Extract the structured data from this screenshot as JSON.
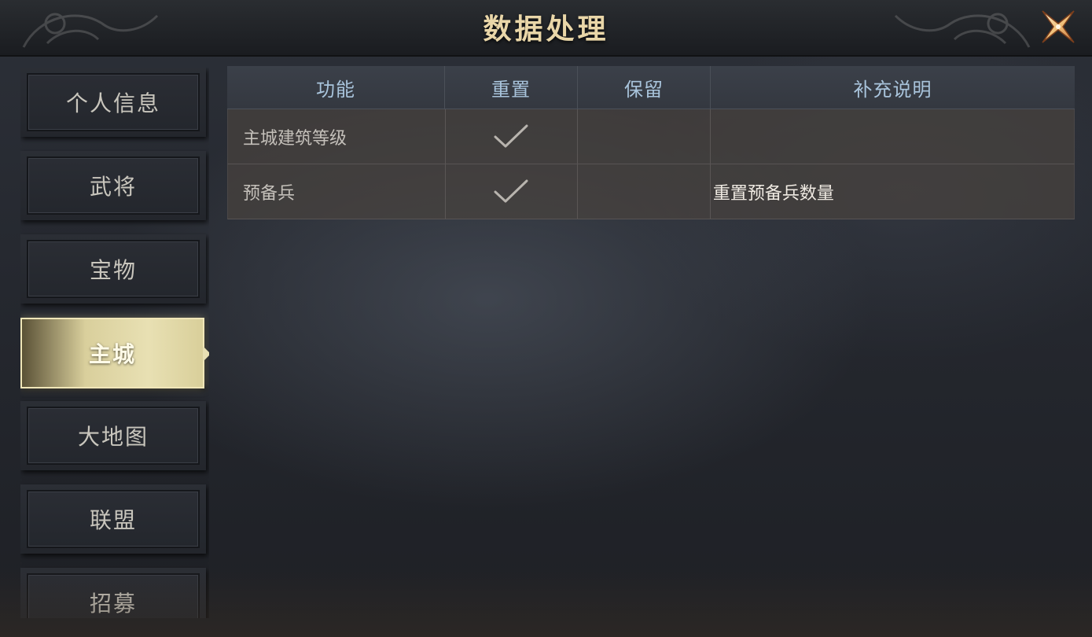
{
  "header": {
    "title": "数据处理"
  },
  "icons": {
    "close": "close-x-icon",
    "check": "checkmark-icon"
  },
  "sidebar": {
    "items": [
      {
        "label": "个人信息",
        "active": false
      },
      {
        "label": "武将",
        "active": false
      },
      {
        "label": "宝物",
        "active": false
      },
      {
        "label": "主城",
        "active": true
      },
      {
        "label": "大地图",
        "active": false
      },
      {
        "label": "联盟",
        "active": false
      },
      {
        "label": "招募",
        "active": false
      }
    ]
  },
  "table": {
    "columns": [
      "功能",
      "重置",
      "保留",
      "补充说明"
    ],
    "rows": [
      {
        "function": "主城建筑等级",
        "reset": true,
        "keep": false,
        "note": ""
      },
      {
        "function": "预备兵",
        "reset": true,
        "keep": false,
        "note": "重置预备兵数量"
      }
    ]
  },
  "colors": {
    "title": "#e9d6a8",
    "header_text": "#a9c4dc",
    "active_tab": "#e8e0b3"
  }
}
